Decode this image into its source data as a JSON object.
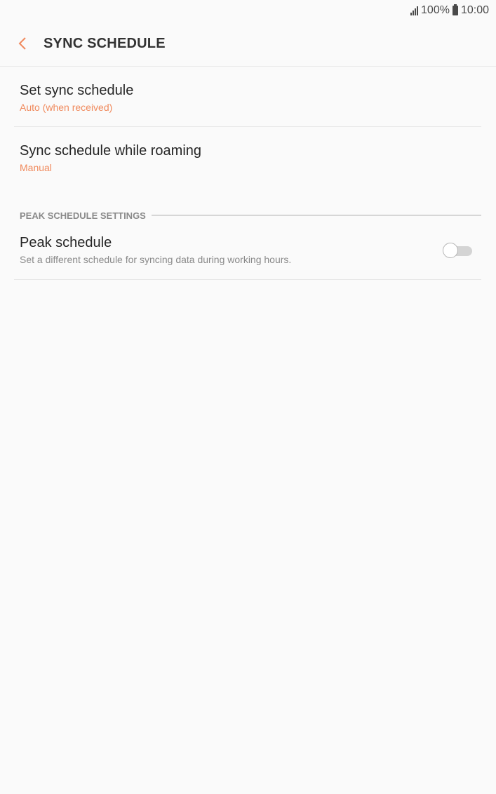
{
  "status_bar": {
    "battery": "100%",
    "time": "10:00"
  },
  "app_bar": {
    "title": "SYNC SCHEDULE"
  },
  "settings": {
    "set_sync_schedule": {
      "title": "Set sync schedule",
      "value": "Auto (when received)"
    },
    "sync_while_roaming": {
      "title": "Sync schedule while roaming",
      "value": "Manual"
    },
    "peak_section": {
      "header": "PEAK SCHEDULE SETTINGS",
      "peak_schedule": {
        "title": "Peak schedule",
        "description": "Set a different schedule for syncing data during working hours.",
        "enabled": false
      }
    }
  },
  "colors": {
    "accent": "#f08a5d",
    "background": "#fafafa"
  }
}
